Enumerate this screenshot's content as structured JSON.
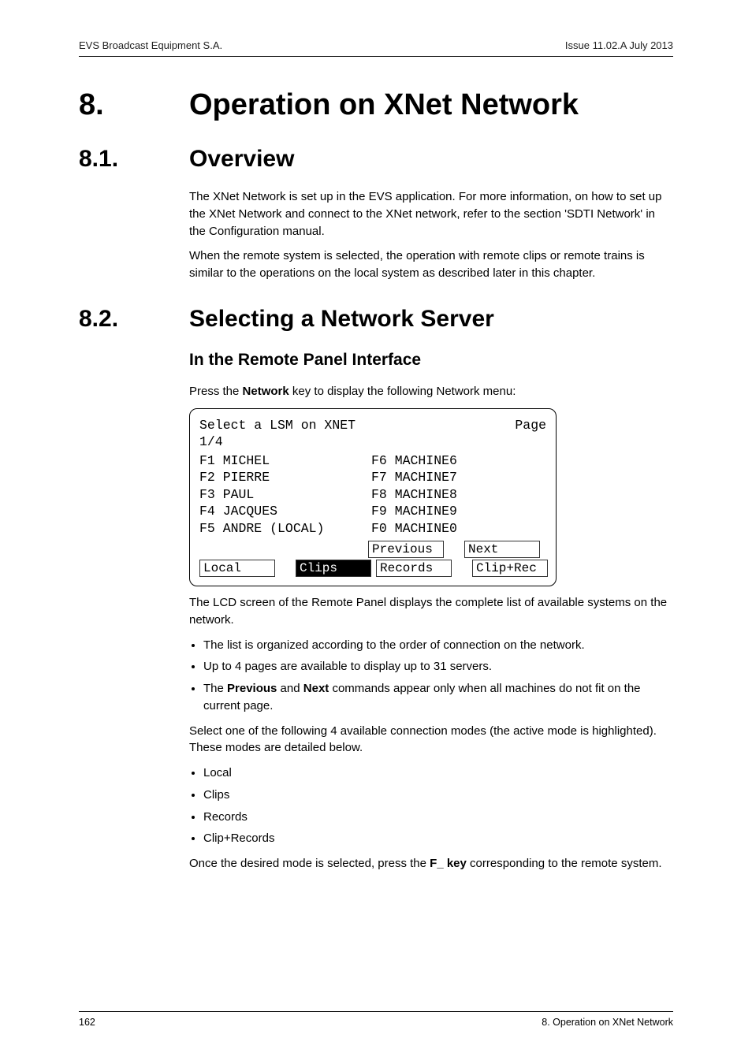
{
  "header": {
    "left": "EVS Broadcast Equipment S.A.",
    "right": "Issue 11.02.A  July 2013"
  },
  "h1": {
    "num": "8.",
    "title": "Operation on XNet Network"
  },
  "s81": {
    "num": "8.1.",
    "title": "Overview",
    "p1": "The XNet Network is set up in the EVS application. For more information, on how to set up the XNet Network and connect to the XNet network, refer to the section 'SDTI Network' in the Configuration manual.",
    "p2": "When the remote system is selected, the operation with remote clips or remote trains is similar to the operations on the local system as described later in this chapter."
  },
  "s82": {
    "num": "8.2.",
    "title": "Selecting a Network Server",
    "h3": "In the Remote Panel Interface",
    "lead_pre": "Press the ",
    "lead_bold": "Network",
    "lead_post": " key to display the following Network menu:",
    "lcd": {
      "head_left": "Select a LSM on XNET",
      "head_right": "Page",
      "page_indicator": "1/4",
      "rows": [
        {
          "l": "F1 MICHEL",
          "r": "F6 MACHINE6"
        },
        {
          "l": "F2 PIERRE",
          "r": "F7 MACHINE7"
        },
        {
          "l": "F3 PAUL",
          "r": "F8 MACHINE8"
        },
        {
          "l": "F4 JACQUES",
          "r": "F9 MACHINE9"
        },
        {
          "l": "F5 ANDRE (LOCAL)",
          "r": "F0 MACHINE0"
        }
      ],
      "btn_row1": {
        "prev": "Previous",
        "next": "Next"
      },
      "btn_row2": {
        "local": "Local",
        "clips": "Clips",
        "records": "Records",
        "cliprec": "Clip+Rec"
      }
    },
    "after1": "The LCD screen of the Remote Panel displays the complete list of available systems on the network.",
    "bullets1": {
      "b1": "The list is organized according to the order of connection on the network.",
      "b2": "Up to 4 pages are available to display up to 31 servers.",
      "b3_pre": "The ",
      "b3_b1": "Previous",
      "b3_mid": " and ",
      "b3_b2": "Next",
      "b3_post": " commands appear only when all machines do not fit on the current page."
    },
    "after2": "Select one of the following 4 available connection modes (the active mode is highlighted). These modes are detailed below.",
    "bullets2": [
      "Local",
      "Clips",
      "Records",
      "Clip+Records"
    ],
    "after3_pre": "Once the desired mode is selected, press the ",
    "after3_bold": "F_  key",
    "after3_post": " corresponding to the remote system."
  },
  "footer": {
    "left": "162",
    "right": "8. Operation on XNet Network"
  }
}
